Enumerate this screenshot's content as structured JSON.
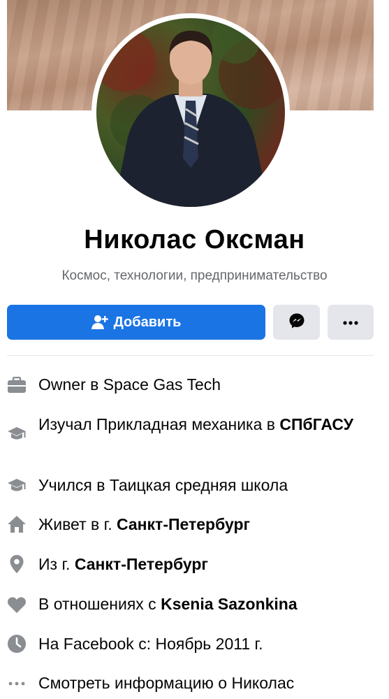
{
  "profile": {
    "name": "Николас Оксман",
    "bio": "Космос, технологии, предпринимательство"
  },
  "actions": {
    "add_label": "Добавить",
    "add_icon": "add-friend-icon",
    "messenger_icon": "messenger-icon",
    "more_icon": "more-dots-icon"
  },
  "about": [
    {
      "icon": "briefcase-icon",
      "prefix": "Owner в Space Gas Tech",
      "bold": ""
    },
    {
      "icon": "graduation-cap-icon",
      "prefix": "Изучал Прикладная механика в ",
      "bold": "СПбГАСУ"
    },
    {
      "icon": "graduation-cap-icon",
      "prefix": "Учился в Таицкая средняя школа",
      "bold": ""
    },
    {
      "icon": "home-icon",
      "prefix": "Живет в г. ",
      "bold": "Санкт-Петербург"
    },
    {
      "icon": "location-pin-icon",
      "prefix": "Из г. ",
      "bold": "Санкт-Петербург"
    },
    {
      "icon": "heart-icon",
      "prefix": "В отношениях с ",
      "bold": "Ksenia Sazonkina"
    },
    {
      "icon": "clock-icon",
      "prefix": "На Facebook с: Ноябрь 2011 г.",
      "bold": ""
    },
    {
      "icon": "more-dots-icon",
      "prefix": "Смотреть информацию о Николас",
      "bold": ""
    }
  ],
  "colors": {
    "accent": "#1b74e4",
    "icon_gray": "#8a8d91",
    "secondary_button": "#e4e6eb"
  }
}
